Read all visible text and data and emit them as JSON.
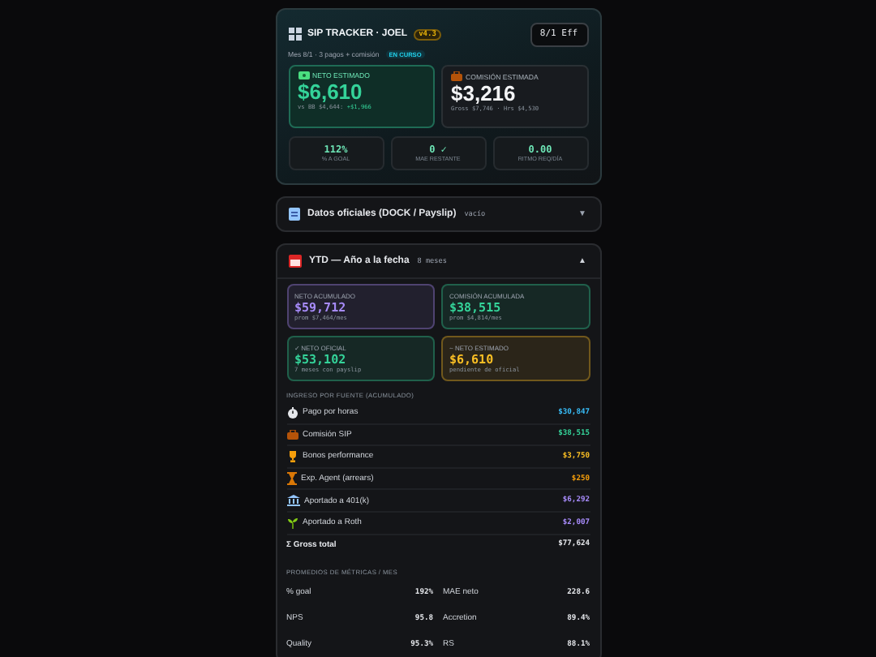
{
  "header": {
    "title": "SIP TRACKER · JOEL",
    "version": "v4.3",
    "period_button": "8/1 Eff",
    "subtitle": "Mes 8/1 · 3 pagos + comisión",
    "status": "EN CURSO",
    "stats": [
      {
        "label": "NETO ESTIMADO",
        "value": "$6,610",
        "note": "vs BB $4,644:",
        "delta": "+$1,966",
        "color": "#34d399"
      },
      {
        "label": "COMISIÓN ESTIMADA",
        "value": "$3,216",
        "note": "Gross $7,746 · Hrs $4,530",
        "color": "#f3f4f6"
      }
    ],
    "kpis": [
      {
        "value": "112%",
        "label": "% A GOAL"
      },
      {
        "value": "0 ✓",
        "label": "MAE RESTANTE"
      },
      {
        "value": "0.00",
        "label": "RITMO REQ/DÍA"
      }
    ]
  },
  "sections": [
    {
      "title": "Datos oficiales (DOCK / Payslip)",
      "note": "vacío",
      "chevron": "▼",
      "expanded": false
    },
    {
      "title": "YTD — Año a la fecha",
      "note": "8 meses",
      "chevron": "▲",
      "expanded": true
    }
  ],
  "ytd": {
    "cards": [
      {
        "label": "NETO ACUMULADO",
        "value": "$59,712",
        "note": "prom $7,464/mes",
        "color": "#a78bfa"
      },
      {
        "label": "COMISIÓN ACUMULADA",
        "value": "$38,515",
        "note": "prom $4,814/mes",
        "color": "#34d399"
      },
      {
        "label": "✓ NETO OFICIAL",
        "value": "$53,102",
        "note": "7 meses con payslip",
        "color": "#34d399"
      },
      {
        "label": "~ NETO ESTIMADO",
        "value": "$6,610",
        "note": "pendiente de oficial",
        "color": "#fbbf24"
      }
    ],
    "income_title": "INGRESO POR FUENTE (ACUMULADO)",
    "income": [
      {
        "label": "Pago por horas",
        "value": "$30,847",
        "color": "#38bdf8"
      },
      {
        "label": "Comisión SIP",
        "value": "$38,515",
        "color": "#34d399"
      },
      {
        "label": "Bonos performance",
        "value": "$3,750",
        "color": "#fbbf24"
      },
      {
        "label": "Exp. Agent (arrears)",
        "value": "$250",
        "color": "#f59e0b"
      },
      {
        "label": "Aportado a 401(k)",
        "value": "$6,292",
        "color": "#a78bfa"
      },
      {
        "label": "Aportado a Roth",
        "value": "$2,007",
        "color": "#a78bfa"
      }
    ],
    "total": {
      "label": "Σ Gross total",
      "value": "$77,624"
    },
    "metrics_title": "PROMEDIOS DE MÉTRICAS / MES",
    "metrics": [
      {
        "label": "% goal",
        "value": "192%"
      },
      {
        "label": "MAE neto",
        "value": "228.6"
      },
      {
        "label": "NPS",
        "value": "95.8"
      },
      {
        "label": "Accretion",
        "value": "89.4%"
      },
      {
        "label": "Quality",
        "value": "95.3%"
      },
      {
        "label": "RS",
        "value": "88.1%"
      }
    ]
  }
}
